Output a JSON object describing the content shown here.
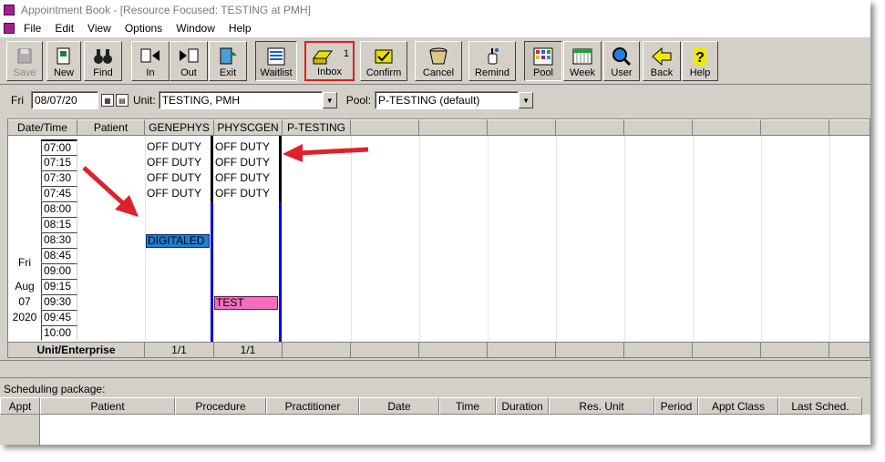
{
  "window": {
    "title": "Appointment Book - [Resource Focused:  TESTING at PMH]"
  },
  "menu": [
    "File",
    "Edit",
    "View",
    "Options",
    "Window",
    "Help"
  ],
  "toolbar": {
    "save": "Save",
    "new": "New",
    "find": "Find",
    "in": "In",
    "out": "Out",
    "exit": "Exit",
    "waitlist": "Waitlist",
    "inbox": "Inbox",
    "inbox_count": "1",
    "confirm": "Confirm",
    "cancel": "Cancel",
    "remind": "Remind",
    "pool": "Pool",
    "week": "Week",
    "user": "User",
    "back": "Back",
    "help": "Help"
  },
  "filter": {
    "day": "Fri",
    "date": "08/07/20",
    "unit_label": "Unit:",
    "unit_value": "TESTING, PMH",
    "pool_label": "Pool:",
    "pool_value": "P-TESTING (default)"
  },
  "grid": {
    "headers": [
      "Date/Time",
      "Patient",
      "GENEPHYS",
      "PHYSCGEN",
      "P-TESTING"
    ],
    "times": [
      "07:00",
      "07:15",
      "07:30",
      "07:45",
      "08:00",
      "08:15",
      "08:30",
      "08:45",
      "09:00",
      "09:15",
      "09:30",
      "09:45",
      "10:00"
    ],
    "date_lines": [
      "Fri",
      "Aug",
      "07",
      "2020"
    ],
    "genephys": [
      "OFF DUTY",
      "OFF DUTY",
      "OFF DUTY",
      "OFF DUTY"
    ],
    "physcgen": [
      "OFF DUTY",
      "OFF DUTY",
      "OFF DUTY",
      "OFF DUTY"
    ],
    "appt_genephys": "DIGITALED",
    "appt_physcgen": "TEST",
    "footer": {
      "label": "Unit/Enterprise",
      "genephys": "1/1",
      "physcgen": "1/1"
    },
    "colors": {
      "appt_blue": "#1e7fd0",
      "appt_pink": "#f46ebe",
      "avail_bar": "#0000e0",
      "offduty_bar": "#000000"
    }
  },
  "scheduling": {
    "label": "Scheduling package:",
    "columns": [
      "Appt",
      "Patient",
      "Procedure",
      "Practitioner",
      "Date",
      "Time",
      "Duration",
      "Res. Unit",
      "Period",
      "Appt Class",
      "Last Sched."
    ]
  }
}
